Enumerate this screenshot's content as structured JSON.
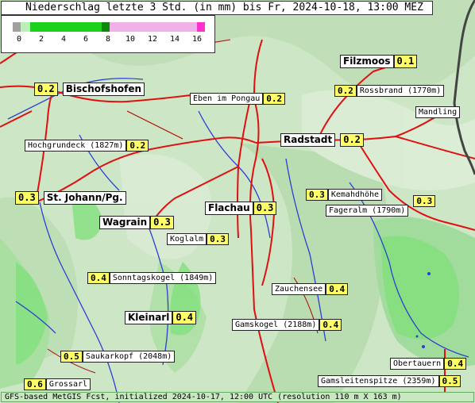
{
  "title": "Niederschlag letzte 3 Std. (in mm) bis Fr, 2024-10-18, 13:00 MEZ",
  "legend": {
    "ticks": [
      "0",
      "2",
      "4",
      "6",
      "8",
      "10",
      "12",
      "14",
      "16"
    ],
    "colors": {
      "none": "#a0a0a0",
      "light": "#b8f0b8",
      "green": "#1bd11b",
      "darkgreen": "#0a8a0a",
      "pink": "#f0b0e8",
      "magenta": "#ff30d0"
    }
  },
  "stations": [
    {
      "name": "Filzmoos",
      "value": "0.1"
    },
    {
      "name": "Bischofshofen",
      "value": "0.2"
    },
    {
      "name": "Eben im Pongau",
      "value": "0.2"
    },
    {
      "name": "Rossbrand (1770m)",
      "value": "0.2"
    },
    {
      "name": "Mandling",
      "value": ""
    },
    {
      "name": "Hochgrundeck (1827m)",
      "value": "0.2"
    },
    {
      "name": "Radstadt",
      "value": "0.2"
    },
    {
      "name": "St. Johann/Pg.",
      "value": "0.3"
    },
    {
      "name": "Kemahdhöhe",
      "value": "0.3"
    },
    {
      "name": "Flachau",
      "value": "0.3"
    },
    {
      "name": "Fageralm (1790m)",
      "value": "0.3"
    },
    {
      "name": "Wagrain",
      "value": "0.3"
    },
    {
      "name": "Koglalm",
      "value": "0.3"
    },
    {
      "name": "Sonntagskogel (1849m)",
      "value": "0.4"
    },
    {
      "name": "Zauchensee",
      "value": "0.4"
    },
    {
      "name": "Kleinarl",
      "value": "0.4"
    },
    {
      "name": "Gamskogel (2188m)",
      "value": "0.4"
    },
    {
      "name": "Saukarkopf (2048m)",
      "value": "0.5"
    },
    {
      "name": "Obertauern",
      "value": "0.4"
    },
    {
      "name": "Grossarl",
      "value": "0.6"
    },
    {
      "name": "Gamsleitenspitze (2359m)",
      "value": "0.5"
    }
  ],
  "footer": "GFS-based MetGIS Fcst, initialized 2024-10-17, 12:00 UTC  (resolution 110 m X 163 m)"
}
